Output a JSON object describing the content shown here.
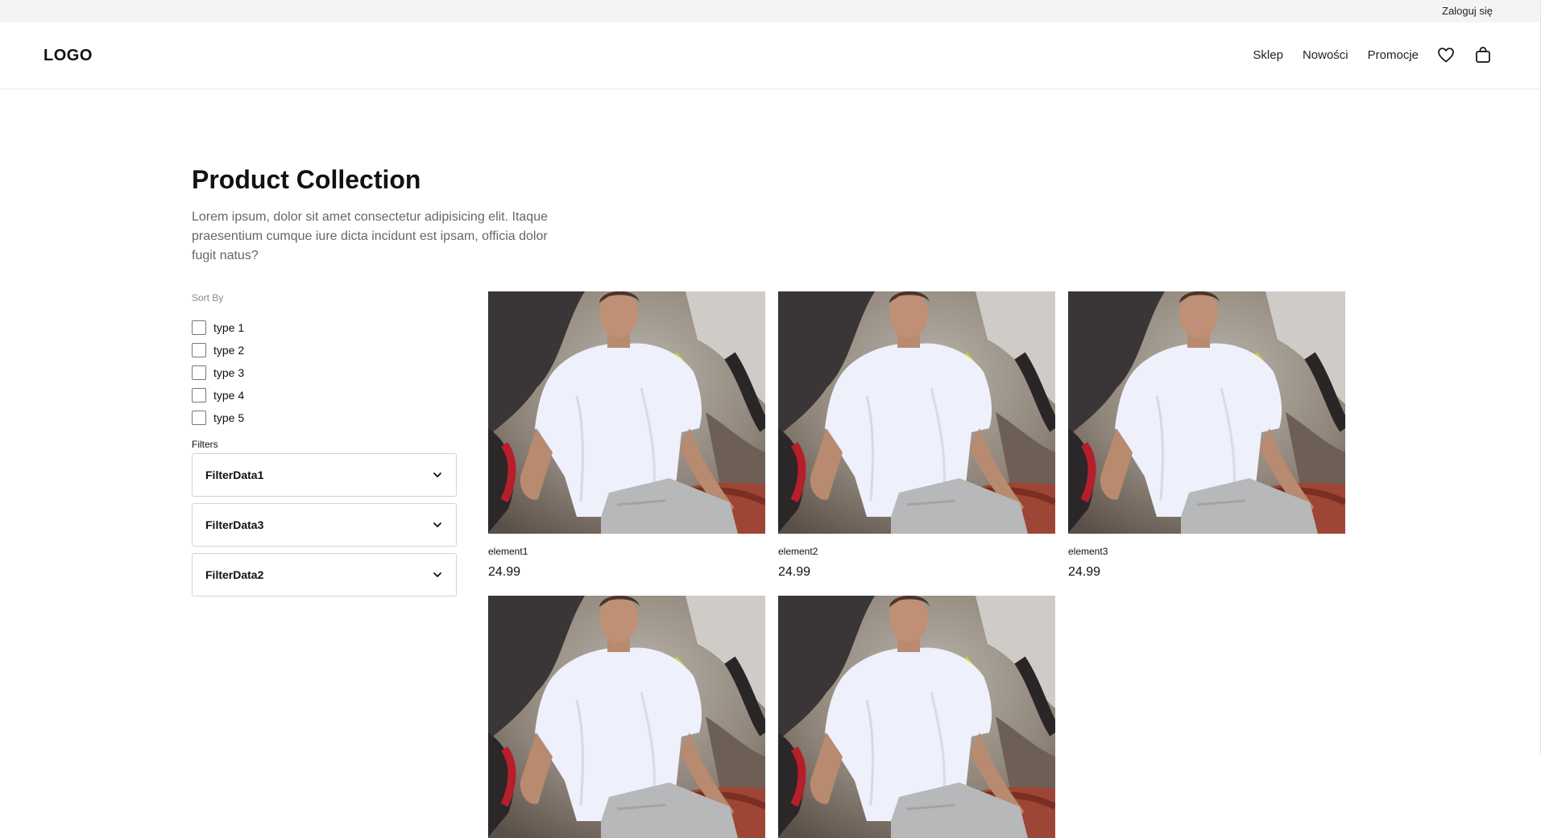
{
  "topbar": {
    "login_label": "Zaloguj się"
  },
  "header": {
    "logo": "LOGO",
    "nav": [
      {
        "label": "Sklep"
      },
      {
        "label": "Nowości"
      },
      {
        "label": "Promocje"
      }
    ],
    "icons": [
      "heart-icon",
      "shopping-bag-icon"
    ]
  },
  "page": {
    "title": "Product Collection",
    "description": "Lorem ipsum, dolor sit amet consectetur adipisicing elit. Itaque praesentium cumque iure dicta incidunt est ipsam, officia dolor fugit natus?"
  },
  "sidebar": {
    "sort_label": "Sort By",
    "sort_options": [
      {
        "label": "type 1",
        "checked": false
      },
      {
        "label": "type 2",
        "checked": false
      },
      {
        "label": "type 3",
        "checked": false
      },
      {
        "label": "type 4",
        "checked": false
      },
      {
        "label": "type 5",
        "checked": false
      }
    ],
    "filters_label": "Filters",
    "filters": [
      {
        "label": "FilterData1"
      },
      {
        "label": "FilterData3"
      },
      {
        "label": "FilterData2"
      }
    ]
  },
  "products": [
    {
      "name": "element1",
      "price": "24.99"
    },
    {
      "name": "element2",
      "price": "24.99"
    },
    {
      "name": "element3",
      "price": "24.99"
    },
    {
      "name": "",
      "price": ""
    },
    {
      "name": "",
      "price": ""
    }
  ]
}
